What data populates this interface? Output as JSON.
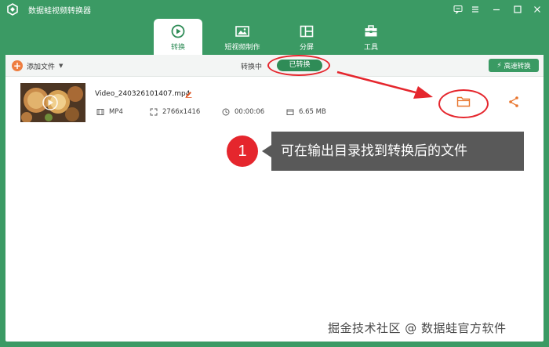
{
  "window": {
    "title": "数据蛙视频转换器",
    "icons": [
      "app-logo-icon",
      "feedback-icon",
      "menu-icon",
      "minimize-icon",
      "maximize-icon",
      "close-icon"
    ]
  },
  "tabs": [
    {
      "label": "转换",
      "icon": "convert-icon",
      "active": true
    },
    {
      "label": "短视频制作",
      "icon": "video-maker-icon",
      "active": false
    },
    {
      "label": "分屏",
      "icon": "split-screen-icon",
      "active": false
    },
    {
      "label": "工具",
      "icon": "toolbox-icon",
      "active": false
    }
  ],
  "toolbar": {
    "add_label": "添加文件",
    "segment_converting": "转换中",
    "segment_converted": "已转换",
    "fast_label": "高速转换"
  },
  "file": {
    "name": "Video_240326101407.mp4",
    "format": "MP4",
    "resolution": "2766x1416",
    "duration": "00:00:06",
    "size": "6.65 MB"
  },
  "annotation": {
    "step": "1",
    "text": "可在输出目录找到转换后的文件"
  },
  "watermark": "掘金技术社区 @ 数据蛙官方软件",
  "colors": {
    "brand": "#3b9a64",
    "accent_green": "#2f8c57",
    "orange": "#ee7d3f",
    "annotation_red": "#e5262d"
  }
}
